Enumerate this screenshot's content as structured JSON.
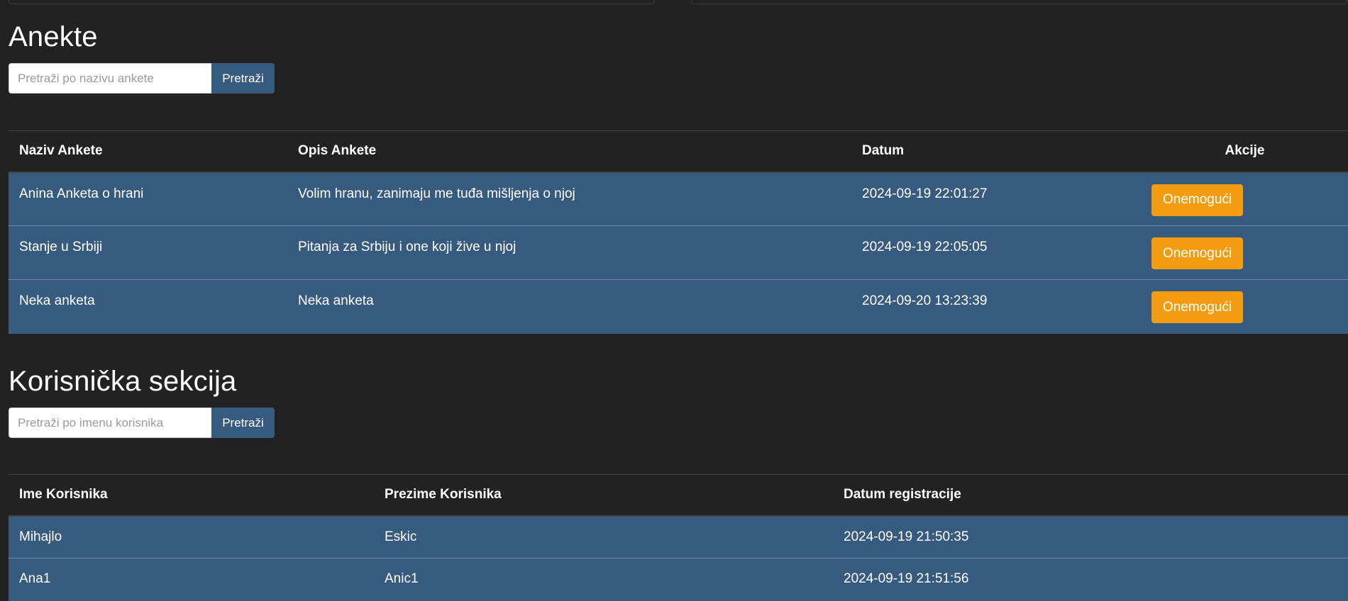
{
  "surveys": {
    "title": "Anekte",
    "search": {
      "placeholder": "Pretraži po nazivu ankete",
      "button_label": "Pretraži"
    },
    "columns": [
      "Naziv Ankete",
      "Opis Ankete",
      "Datum",
      "Akcije"
    ],
    "rows": [
      {
        "name": "Anina Anketa o hrani",
        "description": "Volim hranu, zanimaju me tuđa mišljenja o njoj",
        "date": "2024-09-19 22:01:27",
        "action": "Onemogući"
      },
      {
        "name": "Stanje u Srbiji",
        "description": "Pitanja za Srbiju i one koji žive u njoj",
        "date": "2024-09-19 22:05:05",
        "action": "Onemogući"
      },
      {
        "name": "Neka anketa",
        "description": "Neka anketa",
        "date": "2024-09-20 13:23:39",
        "action": "Onemogući"
      }
    ]
  },
  "users": {
    "title": "Korisnička sekcija",
    "search": {
      "placeholder": "Pretraži po imenu korisnika",
      "button_label": "Pretraži"
    },
    "columns": [
      "Ime Korisnika",
      "Prezime Korisnika",
      "Datum registracije"
    ],
    "rows": [
      {
        "first_name": "Mihajlo",
        "last_name": "Eskic",
        "registered": "2024-09-19 21:50:35"
      },
      {
        "first_name": "Ana1",
        "last_name": "Anic1",
        "registered": "2024-09-19 21:51:56"
      }
    ]
  },
  "colors": {
    "background": "#222222",
    "primary": "#375a7f",
    "warning": "#f39c12",
    "text": "#ffffff"
  }
}
